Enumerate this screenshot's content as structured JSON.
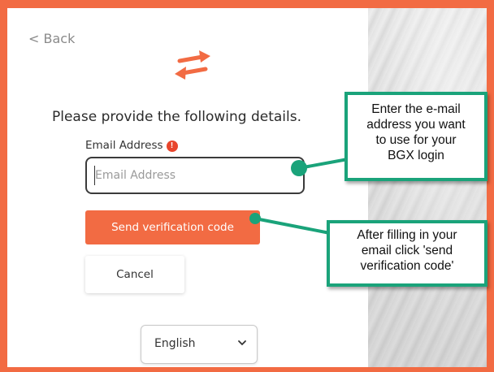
{
  "nav": {
    "back_label": "< Back"
  },
  "logo": {
    "icon": "bidirectional-arrows-icon",
    "color": "#f26b43"
  },
  "form": {
    "heading": "Please provide the following details.",
    "email_label": "Email Address",
    "email_info_glyph": "!",
    "email_placeholder": "Email Address",
    "email_value": "",
    "send_button_label": "Send verification code",
    "cancel_button_label": "Cancel",
    "language_selected": "English"
  },
  "callouts": [
    {
      "lines": [
        "Enter the e-mail",
        "address you want",
        "to use for your",
        "BGX login"
      ]
    },
    {
      "lines": [
        "After filling in your",
        "email click 'send",
        "verification code'"
      ]
    }
  ],
  "colors": {
    "accent": "#f26b43",
    "callout_border": "#1aa37a",
    "info_icon": "#e8452c"
  }
}
